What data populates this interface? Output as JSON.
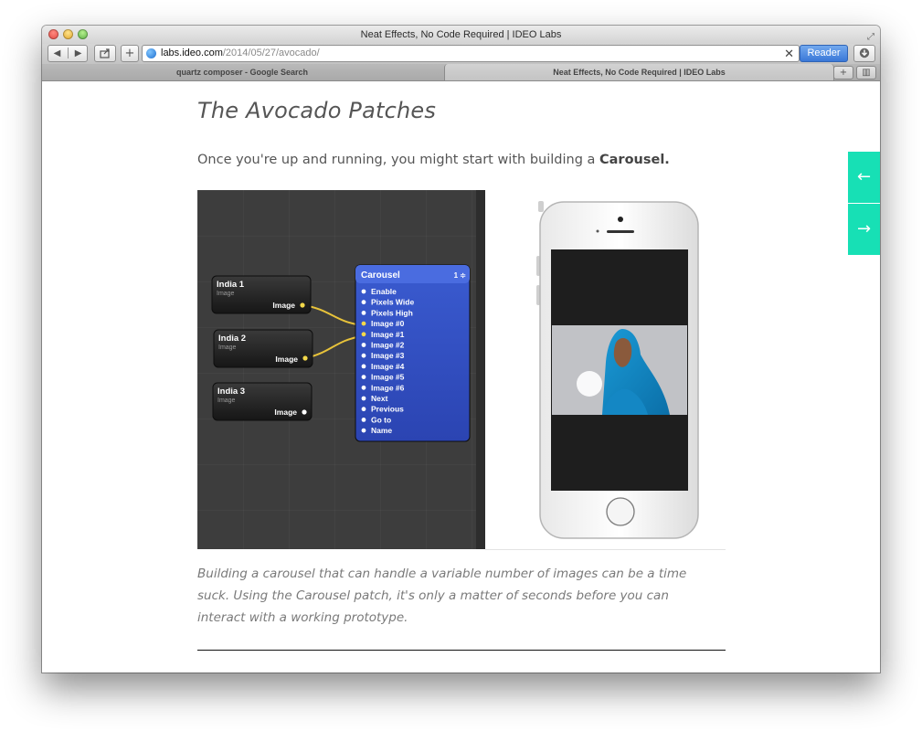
{
  "window": {
    "title": "Neat Effects, No Code Required | IDEO Labs"
  },
  "toolbar": {
    "back_glyph": "◀",
    "forward_glyph": "▶",
    "url_host": "labs.ideo.com",
    "url_path": "/2014/05/27/avocado/",
    "reader_label": "Reader"
  },
  "tabs": [
    {
      "label": "quartz composer - Google Search"
    },
    {
      "label": "Neat Effects, No Code Required | IDEO Labs"
    }
  ],
  "article": {
    "heading": "The Avocado Patches",
    "intro_text": "Once you're up and running, you might start with building a ",
    "intro_bold": "Carousel.",
    "caption": "Building a carousel that can handle a variable number of images can be a time suck. Using the Carousel patch, it's only a matter of seconds before you can interact with a working prototype."
  },
  "qc_patches": [
    {
      "title": "India 1",
      "subtitle": "Image",
      "port": "Image"
    },
    {
      "title": "India 2",
      "subtitle": "Image",
      "port": "Image"
    },
    {
      "title": "India 3",
      "subtitle": "Image",
      "port": "Image"
    }
  ],
  "carousel_patch": {
    "title": "Carousel",
    "count": "1 ≑",
    "inputs": [
      "Enable",
      "Pixels Wide",
      "Pixels High",
      "Image #0",
      "Image #1",
      "Image #2",
      "Image #3",
      "Image #4",
      "Image #5",
      "Image #6",
      "Next",
      "Previous",
      "Go to",
      "Name"
    ]
  },
  "side_nav": {
    "prev_glyph": "←",
    "next_glyph": "→"
  },
  "colors": {
    "accent_teal": "#17e0b5",
    "reader_blue": "#3a78d8",
    "carousel_blue": "#2f4fbf",
    "connection_yellow": "#e8c33a"
  },
  "icons": [
    "back-icon",
    "forward-icon",
    "share-icon",
    "add-bookmark-icon",
    "globe-icon",
    "stop-icon",
    "download-icon",
    "fullscreen-icon",
    "new-tab-icon",
    "tab-list-icon",
    "arrow-left-icon",
    "arrow-right-icon"
  ]
}
